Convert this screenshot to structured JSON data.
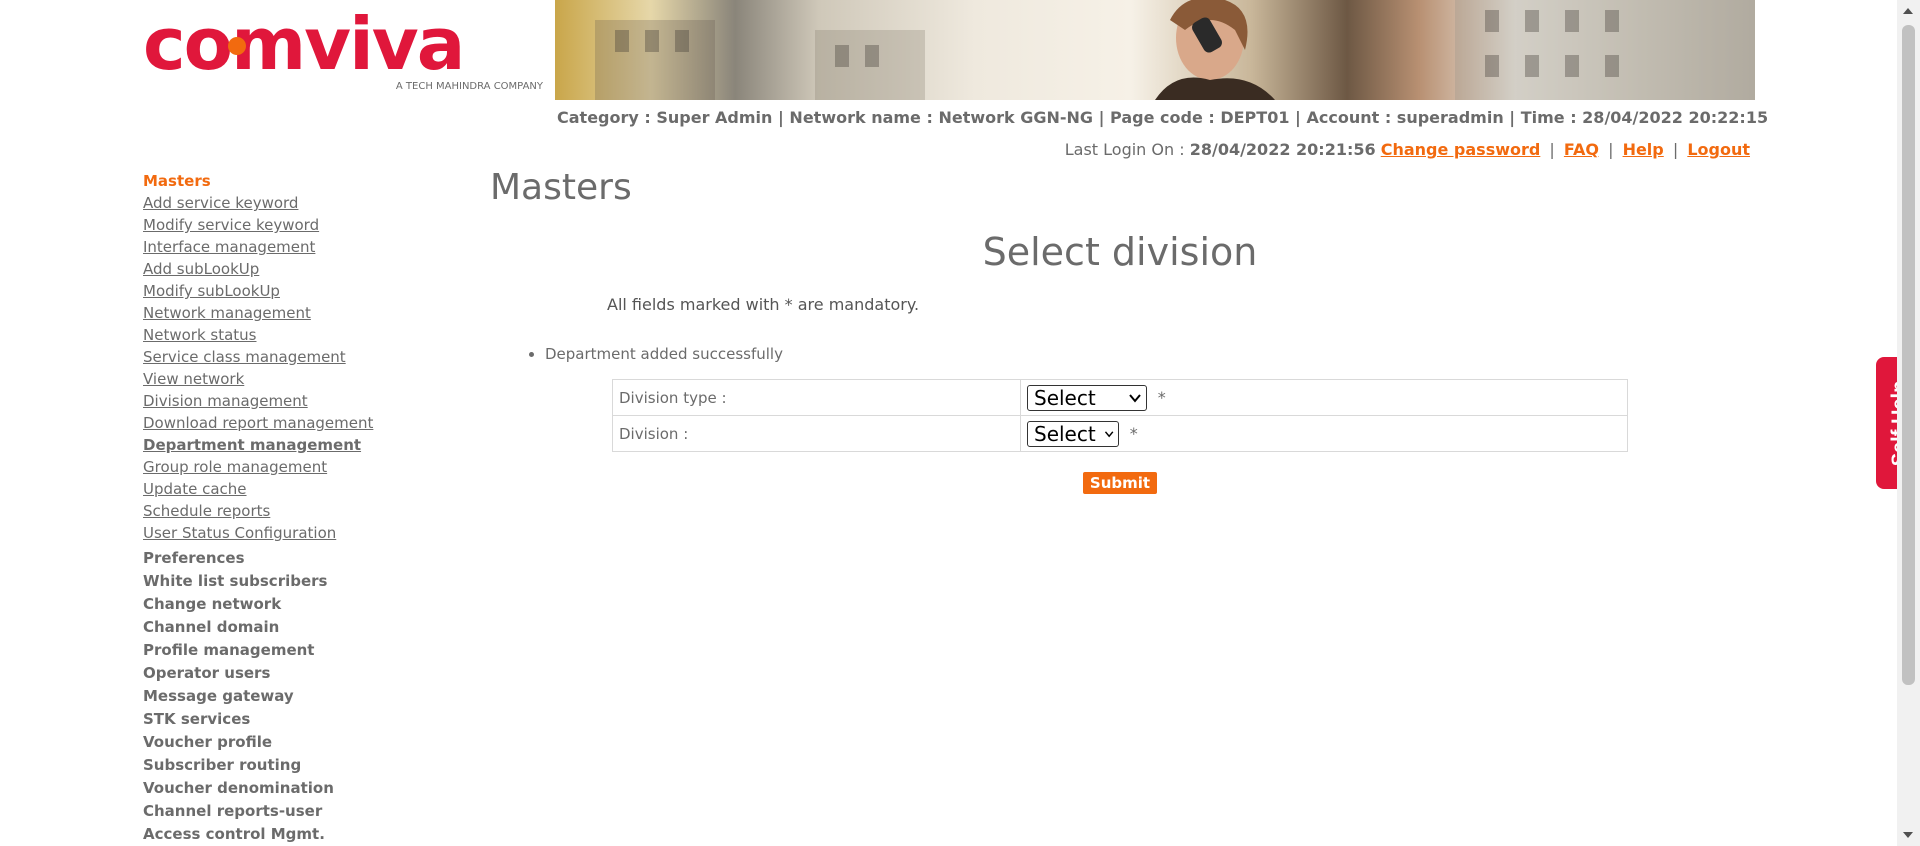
{
  "brand": {
    "name": "comviva",
    "tagline": "A TECH MAHINDRA COMPANY",
    "color": "#e0173b",
    "accent": "#f26a0f"
  },
  "infobar": {
    "category_label": "Category :",
    "category": "Super Admin",
    "network_label": "Network name :",
    "network": "Network GGN-NG",
    "pagecode_label": "Page code :",
    "pagecode": "DEPT01",
    "account_label": "Account :",
    "account": "superadmin",
    "time_label": "Time :",
    "time": "28/04/2022 20:22:15",
    "separator": "|"
  },
  "lastlogin": {
    "label": "Last Login On :",
    "value": "28/04/2022 20:21:56",
    "change_password": "Change password",
    "faq": "FAQ",
    "help": "Help",
    "logout": "Logout",
    "separator": "|"
  },
  "sidebar": {
    "heading": "Masters",
    "links": [
      "Add service keyword",
      "Modify service keyword",
      "Interface management",
      "Add subLookUp",
      "Modify subLookUp",
      "Network management",
      "Network status",
      "Service class management",
      "View network",
      "Division management",
      "Download report management",
      "Department management",
      "Group role management",
      "Update cache",
      "Schedule reports",
      "User Status Configuration"
    ],
    "groups": [
      "Preferences",
      "White list subscribers",
      "Change network",
      "Channel domain",
      "Profile management",
      "Operator users",
      "Message gateway",
      "STK services",
      "Voucher profile",
      "Subscriber routing",
      "Voucher denomination",
      "Channel reports-user",
      "Access control Mgmt."
    ]
  },
  "main": {
    "title": "Masters",
    "section_title": "Select division",
    "mandatory_note": "All fields marked with * are mandatory.",
    "message": "Department added successfully",
    "fields": {
      "division_type": {
        "label": "Division type :",
        "value": "Select",
        "required": "*"
      },
      "division": {
        "label": "Division :",
        "value": "Select",
        "required": "*"
      }
    },
    "submit": "Submit"
  },
  "selfhelp": {
    "label": "Self Help",
    "color": "#e0173b"
  }
}
